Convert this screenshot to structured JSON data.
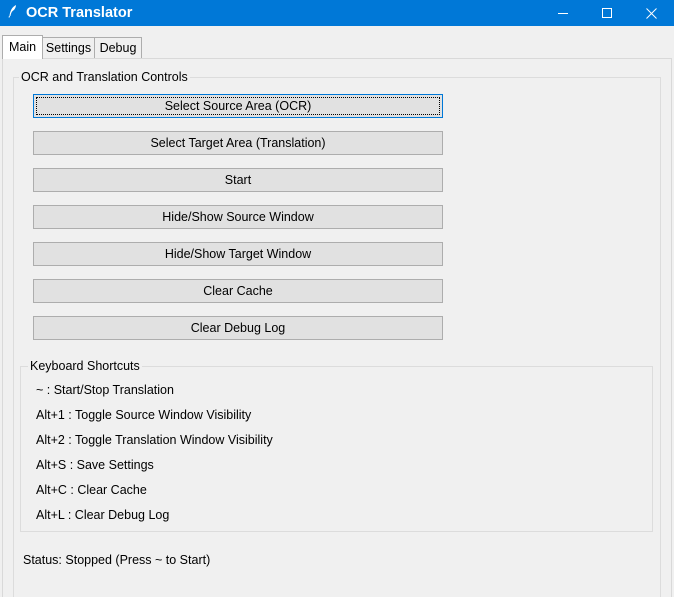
{
  "window": {
    "title": "OCR Translator",
    "icon": "feather-icon",
    "accent": "#0078d7"
  },
  "tabs": [
    {
      "label": "Main",
      "active": true
    },
    {
      "label": "Settings",
      "active": false
    },
    {
      "label": "Debug",
      "active": false
    }
  ],
  "controls": {
    "legend": "OCR and Translation Controls",
    "buttons": [
      {
        "label": "Select Source Area (OCR)"
      },
      {
        "label": "Select Target Area (Translation)"
      },
      {
        "label": "Start"
      },
      {
        "label": "Hide/Show Source Window"
      },
      {
        "label": "Hide/Show Target Window"
      },
      {
        "label": "Clear Cache"
      },
      {
        "label": "Clear Debug Log"
      }
    ]
  },
  "shortcuts": {
    "legend": "Keyboard Shortcuts",
    "lines": [
      "~ : Start/Stop Translation",
      "Alt+1 : Toggle Source Window Visibility",
      "Alt+2 : Toggle Translation Window Visibility",
      "Alt+S : Save Settings",
      "Alt+C : Clear Cache",
      "Alt+L : Clear Debug Log"
    ]
  },
  "status": {
    "text": "Status: Stopped (Press ~ to Start)"
  }
}
